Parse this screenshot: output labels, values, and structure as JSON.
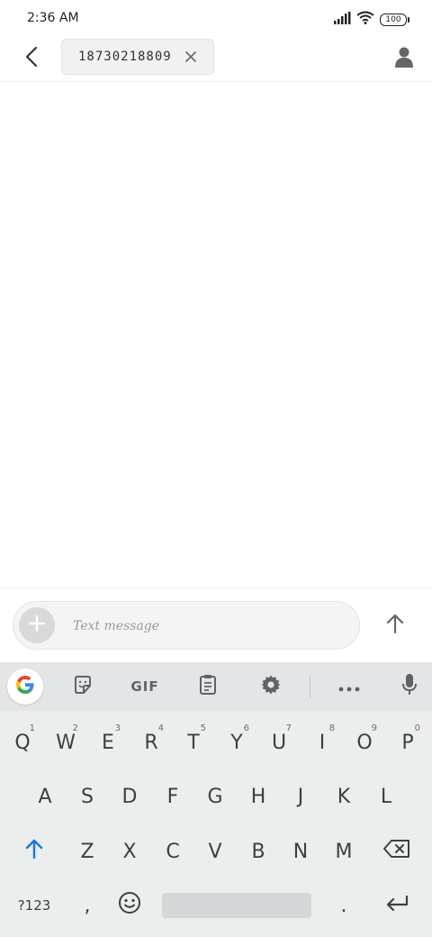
{
  "status_bar": {
    "time": "2:36 AM",
    "battery": "100"
  },
  "header": {
    "recipient": "18730218809"
  },
  "compose": {
    "placeholder": "Text message"
  },
  "keyboard": {
    "gif_label": "GIF",
    "row1": [
      {
        "key": "Q",
        "hint": "1"
      },
      {
        "key": "W",
        "hint": "2"
      },
      {
        "key": "E",
        "hint": "3"
      },
      {
        "key": "R",
        "hint": "4"
      },
      {
        "key": "T",
        "hint": "5"
      },
      {
        "key": "Y",
        "hint": "6"
      },
      {
        "key": "U",
        "hint": "7"
      },
      {
        "key": "I",
        "hint": "8"
      },
      {
        "key": "O",
        "hint": "9"
      },
      {
        "key": "P",
        "hint": "0"
      }
    ],
    "row2": [
      "A",
      "S",
      "D",
      "F",
      "G",
      "H",
      "J",
      "K",
      "L"
    ],
    "row3": [
      "Z",
      "X",
      "C",
      "V",
      "B",
      "N",
      "M"
    ],
    "row4": {
      "symbols": "?123",
      "comma": ",",
      "period": "."
    }
  },
  "colors": {
    "accent_blue": "#1a73e8",
    "icon_gray": "#5f6368"
  }
}
